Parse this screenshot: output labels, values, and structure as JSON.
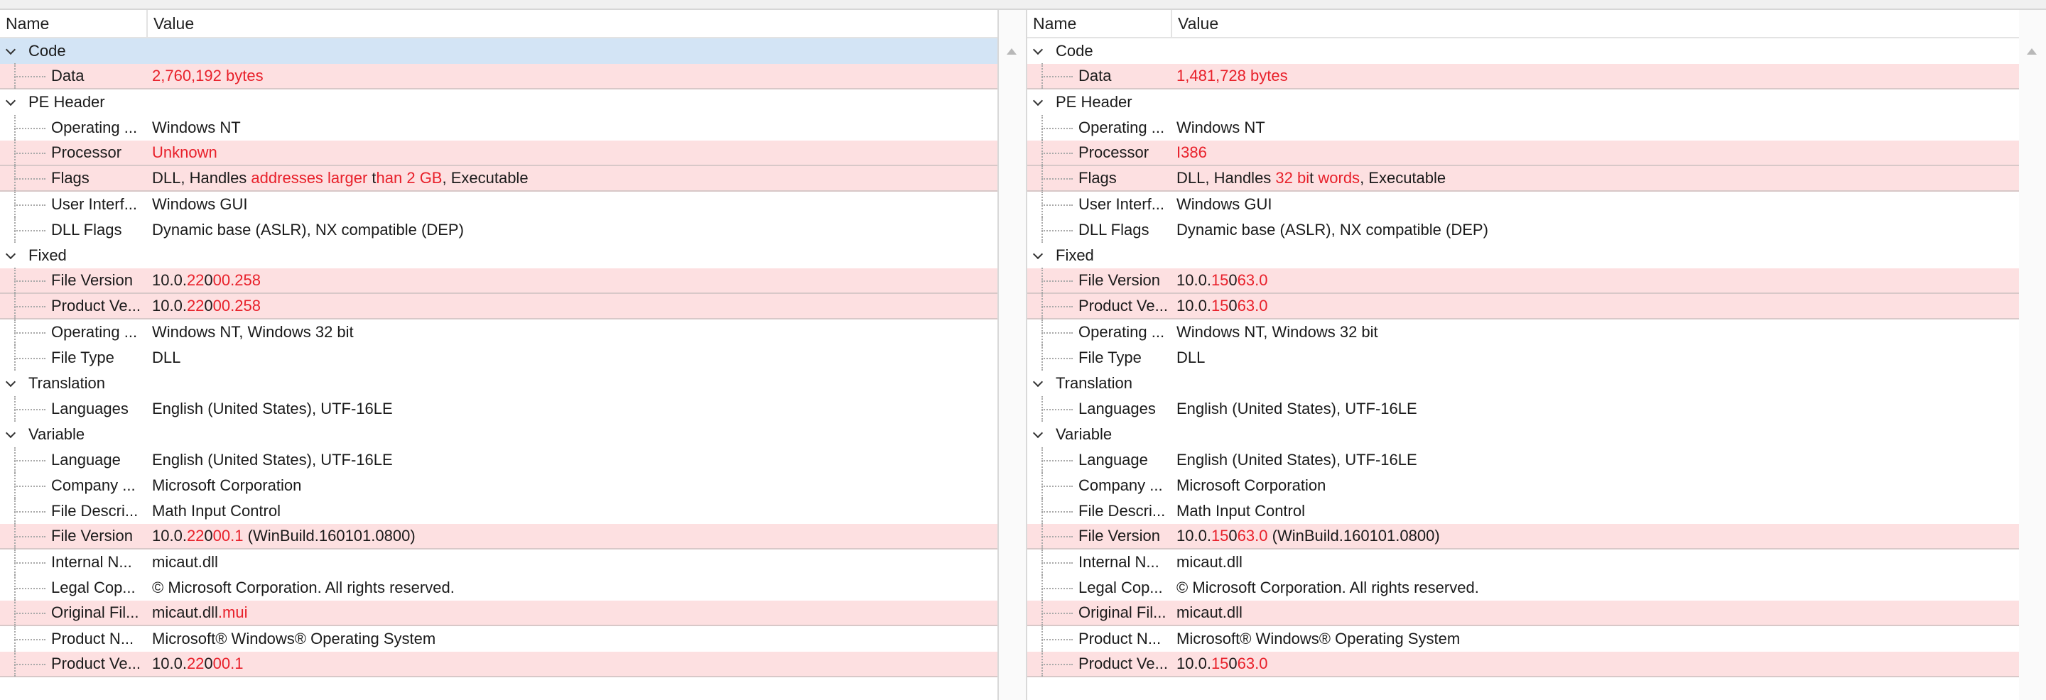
{
  "left": {
    "header": {
      "name": "Name",
      "value": "Value"
    },
    "rows": [
      {
        "kind": "group",
        "name": "Code",
        "selected": true,
        "segments": []
      },
      {
        "kind": "child",
        "name": "Data",
        "diff": true,
        "segments": [
          {
            "t": "2,760,192 bytes",
            "r": true
          }
        ]
      },
      {
        "kind": "group",
        "name": "PE Header",
        "segments": []
      },
      {
        "kind": "child",
        "name": "Operating ...",
        "segments": [
          {
            "t": "Windows NT"
          }
        ]
      },
      {
        "kind": "child",
        "name": "Processor",
        "diff": true,
        "segments": [
          {
            "t": "Unknown",
            "r": true
          }
        ]
      },
      {
        "kind": "child",
        "name": "Flags",
        "diff": true,
        "segments": [
          {
            "t": "DLL, Handles "
          },
          {
            "t": "addresses larger ",
            "r": true
          },
          {
            "t": "t"
          },
          {
            "t": "han 2 GB",
            "r": true
          },
          {
            "t": ", Executable"
          }
        ]
      },
      {
        "kind": "child",
        "name": "User Interf...",
        "segments": [
          {
            "t": "Windows GUI"
          }
        ]
      },
      {
        "kind": "child",
        "name": "DLL Flags",
        "segments": [
          {
            "t": "Dynamic base (ASLR), NX compatible (DEP)"
          }
        ]
      },
      {
        "kind": "group",
        "name": "Fixed",
        "segments": []
      },
      {
        "kind": "child",
        "name": "File Version",
        "diff": true,
        "segments": [
          {
            "t": "10.0."
          },
          {
            "t": "22",
            "r": true
          },
          {
            "t": "0"
          },
          {
            "t": "00.258",
            "r": true
          }
        ]
      },
      {
        "kind": "child",
        "name": "Product Ve...",
        "diff": true,
        "segments": [
          {
            "t": "10.0."
          },
          {
            "t": "22",
            "r": true
          },
          {
            "t": "0"
          },
          {
            "t": "00.258",
            "r": true
          }
        ]
      },
      {
        "kind": "child",
        "name": "Operating ...",
        "segments": [
          {
            "t": "Windows NT, Windows 32 bit"
          }
        ]
      },
      {
        "kind": "child",
        "name": "File Type",
        "segments": [
          {
            "t": "DLL"
          }
        ]
      },
      {
        "kind": "group",
        "name": "Translation",
        "segments": []
      },
      {
        "kind": "child",
        "name": "Languages",
        "segments": [
          {
            "t": "English (United States), UTF-16LE"
          }
        ]
      },
      {
        "kind": "group",
        "name": "Variable",
        "segments": []
      },
      {
        "kind": "child",
        "name": "Language",
        "segments": [
          {
            "t": "English (United States), UTF-16LE"
          }
        ]
      },
      {
        "kind": "child",
        "name": "Company ...",
        "segments": [
          {
            "t": "Microsoft Corporation"
          }
        ]
      },
      {
        "kind": "child",
        "name": "File Descri...",
        "segments": [
          {
            "t": "Math Input Control"
          }
        ]
      },
      {
        "kind": "child",
        "name": "File Version",
        "diff": true,
        "segments": [
          {
            "t": "10.0."
          },
          {
            "t": "22",
            "r": true
          },
          {
            "t": "0"
          },
          {
            "t": "00.1",
            "r": true
          },
          {
            "t": " (WinBuild.160101.0800)"
          }
        ]
      },
      {
        "kind": "child",
        "name": "Internal N...",
        "segments": [
          {
            "t": "micaut.dll"
          }
        ]
      },
      {
        "kind": "child",
        "name": "Legal Cop...",
        "segments": [
          {
            "t": "© Microsoft Corporation. All rights reserved."
          }
        ]
      },
      {
        "kind": "child",
        "name": "Original Fil...",
        "diff": true,
        "segments": [
          {
            "t": "micaut.dll"
          },
          {
            "t": ".mui",
            "r": true
          }
        ]
      },
      {
        "kind": "child",
        "name": "Product N...",
        "segments": [
          {
            "t": "Microsoft® Windows® Operating System"
          }
        ]
      },
      {
        "kind": "child",
        "name": "Product Ve...",
        "diff": true,
        "segments": [
          {
            "t": "10.0."
          },
          {
            "t": "22",
            "r": true
          },
          {
            "t": "0"
          },
          {
            "t": "00.1",
            "r": true
          }
        ]
      }
    ]
  },
  "right": {
    "header": {
      "name": "Name",
      "value": "Value"
    },
    "rows": [
      {
        "kind": "group",
        "name": "Code",
        "segments": []
      },
      {
        "kind": "child",
        "name": "Data",
        "diff": true,
        "segments": [
          {
            "t": "1,481,728 bytes",
            "r": true
          }
        ]
      },
      {
        "kind": "group",
        "name": "PE Header",
        "segments": []
      },
      {
        "kind": "child",
        "name": "Operating ...",
        "segments": [
          {
            "t": "Windows NT"
          }
        ]
      },
      {
        "kind": "child",
        "name": "Processor",
        "diff": true,
        "segments": [
          {
            "t": "I386",
            "r": true
          }
        ]
      },
      {
        "kind": "child",
        "name": "Flags",
        "diff": true,
        "segments": [
          {
            "t": "DLL, Handles "
          },
          {
            "t": "32 bi",
            "r": true
          },
          {
            "t": "t "
          },
          {
            "t": "words",
            "r": true
          },
          {
            "t": ", Executable"
          }
        ]
      },
      {
        "kind": "child",
        "name": "User Interf...",
        "segments": [
          {
            "t": "Windows GUI"
          }
        ]
      },
      {
        "kind": "child",
        "name": "DLL Flags",
        "segments": [
          {
            "t": "Dynamic base (ASLR), NX compatible (DEP)"
          }
        ]
      },
      {
        "kind": "group",
        "name": "Fixed",
        "segments": []
      },
      {
        "kind": "child",
        "name": "File Version",
        "diff": true,
        "segments": [
          {
            "t": "10.0."
          },
          {
            "t": "15",
            "r": true
          },
          {
            "t": "0"
          },
          {
            "t": "63.0",
            "r": true
          }
        ]
      },
      {
        "kind": "child",
        "name": "Product Ve...",
        "diff": true,
        "segments": [
          {
            "t": "10.0."
          },
          {
            "t": "15",
            "r": true
          },
          {
            "t": "0"
          },
          {
            "t": "63.0",
            "r": true
          }
        ]
      },
      {
        "kind": "child",
        "name": "Operating ...",
        "segments": [
          {
            "t": "Windows NT, Windows 32 bit"
          }
        ]
      },
      {
        "kind": "child",
        "name": "File Type",
        "segments": [
          {
            "t": "DLL"
          }
        ]
      },
      {
        "kind": "group",
        "name": "Translation",
        "segments": []
      },
      {
        "kind": "child",
        "name": "Languages",
        "segments": [
          {
            "t": "English (United States), UTF-16LE"
          }
        ]
      },
      {
        "kind": "group",
        "name": "Variable",
        "segments": []
      },
      {
        "kind": "child",
        "name": "Language",
        "segments": [
          {
            "t": "English (United States), UTF-16LE"
          }
        ]
      },
      {
        "kind": "child",
        "name": "Company ...",
        "segments": [
          {
            "t": "Microsoft Corporation"
          }
        ]
      },
      {
        "kind": "child",
        "name": "File Descri...",
        "segments": [
          {
            "t": "Math Input Control"
          }
        ]
      },
      {
        "kind": "child",
        "name": "File Version",
        "diff": true,
        "segments": [
          {
            "t": "10.0."
          },
          {
            "t": "15",
            "r": true
          },
          {
            "t": "0"
          },
          {
            "t": "63.0",
            "r": true
          },
          {
            "t": " (WinBuild.160101.0800)"
          }
        ]
      },
      {
        "kind": "child",
        "name": "Internal N...",
        "segments": [
          {
            "t": "micaut.dll"
          }
        ]
      },
      {
        "kind": "child",
        "name": "Legal Cop...",
        "segments": [
          {
            "t": "© Microsoft Corporation. All rights reserved."
          }
        ]
      },
      {
        "kind": "child",
        "name": "Original Fil...",
        "diff": true,
        "segments": [
          {
            "t": "micaut.dll"
          }
        ]
      },
      {
        "kind": "child",
        "name": "Product N...",
        "segments": [
          {
            "t": "Microsoft® Windows® Operating System"
          }
        ]
      },
      {
        "kind": "child",
        "name": "Product Ve...",
        "diff": true,
        "segments": [
          {
            "t": "10.0."
          },
          {
            "t": "15",
            "r": true
          },
          {
            "t": "0"
          },
          {
            "t": "63.0",
            "r": true
          }
        ]
      }
    ]
  },
  "icons": {
    "expander": "chevron-down-icon",
    "scroll_up": "scroll-up-arrow-icon"
  },
  "colors": {
    "diff_row_bg": "#fde0e1",
    "diff_text": "#e8202a",
    "selected_row_bg": "#d3e4f5"
  }
}
